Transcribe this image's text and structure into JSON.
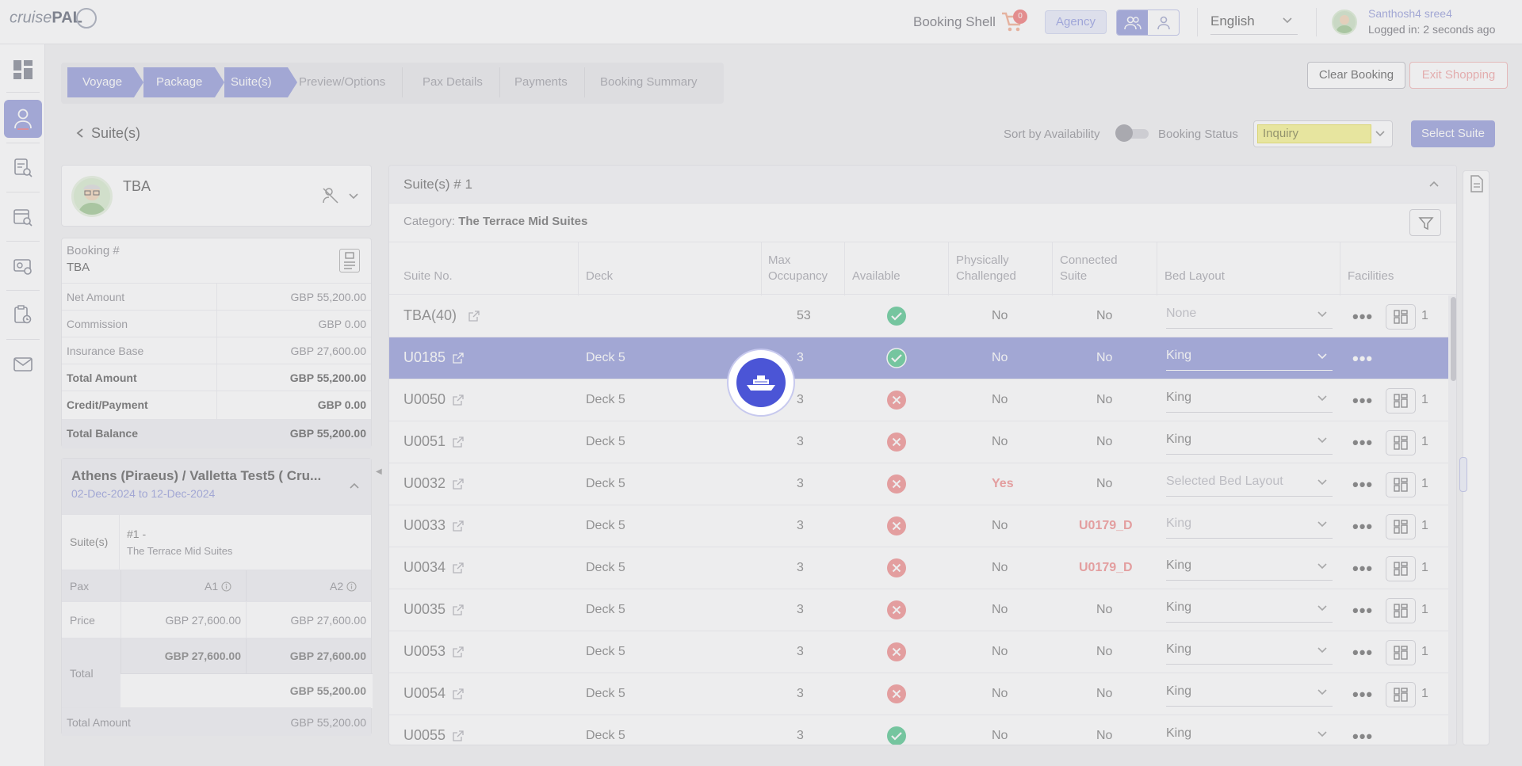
{
  "header": {
    "logo_text": "cruise",
    "logo_bold": "PAL",
    "booking_shell": "Booking Shell",
    "cart_count": "0",
    "agency": "Agency",
    "language": "English",
    "user_name": "Santhosh4 sree4",
    "logged_in": "Logged in: 2 seconds ago"
  },
  "stepper": {
    "steps": [
      "Voyage",
      "Package",
      "Suite(s)",
      "Preview/Options",
      "Pax Details",
      "Payments",
      "Booking Summary"
    ],
    "current": 2
  },
  "actions": {
    "clear_booking": "Clear Booking",
    "exit_shopping": "Exit Shopping"
  },
  "subbar": {
    "back_title": "Suite(s)",
    "sort_label": "Sort by Availability",
    "sort_on": false,
    "status_label": "Booking Status",
    "status_value": "Inquiry",
    "select_suite": "Select Suite"
  },
  "pax_card": {
    "name": "TBA"
  },
  "booking": {
    "label": "Booking #",
    "number": "TBA",
    "rows": [
      {
        "k": "Net Amount",
        "v": "GBP 55,200.00"
      },
      {
        "k": "Commission",
        "v": "GBP 0.00"
      },
      {
        "k": "Insurance Base",
        "v": "GBP 27,600.00"
      },
      {
        "k": "Total Amount",
        "v": "GBP 55,200.00"
      },
      {
        "k": "Credit/Payment",
        "v": "GBP 0.00"
      },
      {
        "k": "Total Balance",
        "v": "GBP 55,200.00"
      }
    ]
  },
  "voyage": {
    "title": "Athens (Piraeus) / Valletta Test5 ( Cru...",
    "dates": "02-Dec-2024 to 12-Dec-2024",
    "suites_label": "Suite(s)",
    "suite_no": "#1 -",
    "suite_cat": "The Terrace Mid Suites",
    "pax_label": "Pax",
    "a1": "A1",
    "a2": "A2",
    "price_label": "Price",
    "price_a1": "GBP 27,600.00",
    "price_a2": "GBP 27,600.00",
    "total_label": "Total",
    "total_a1": "GBP 27,600.00",
    "total_a2": "GBP 27,600.00",
    "total_sum": "GBP 55,200.00",
    "total_amount_label": "Total Amount",
    "total_amount": "GBP 55,200.00"
  },
  "suites": {
    "title": "Suite(s) # 1",
    "category_label": "Category:",
    "category": "The Terrace Mid Suites",
    "columns": [
      "Suite No.",
      "Deck",
      "Max\nOccupancy",
      "Available",
      "Physically\nChallenged",
      "Connected\nSuite",
      "Bed Layout",
      "Facilities"
    ],
    "rows": [
      {
        "no": "TBA(40)",
        "deck": "",
        "occ": "53",
        "avail": true,
        "pc": "No",
        "conn": "No",
        "bed": "None",
        "fac": "1",
        "bed_muted": true
      },
      {
        "no": "U0185",
        "deck": "Deck 5",
        "occ": "3",
        "avail": true,
        "pc": "No",
        "conn": "No",
        "bed": "King",
        "fac": "",
        "selected": true
      },
      {
        "no": "U0050",
        "deck": "Deck 5",
        "occ": "3",
        "avail": false,
        "pc": "No",
        "conn": "No",
        "bed": "King",
        "fac": "1"
      },
      {
        "no": "U0051",
        "deck": "Deck 5",
        "occ": "3",
        "avail": false,
        "pc": "No",
        "conn": "No",
        "bed": "King",
        "fac": "1"
      },
      {
        "no": "U0032",
        "deck": "Deck 5",
        "occ": "3",
        "avail": false,
        "pc": "Yes",
        "conn": "No",
        "bed": "Selected Bed Layout",
        "fac": "1",
        "bed_muted": true
      },
      {
        "no": "U0033",
        "deck": "Deck 5",
        "occ": "3",
        "avail": false,
        "pc": "No",
        "conn": "U0179_D",
        "bed": "King",
        "fac": "1",
        "bed_muted": true
      },
      {
        "no": "U0034",
        "deck": "Deck 5",
        "occ": "3",
        "avail": false,
        "pc": "No",
        "conn": "U0179_D",
        "bed": "King",
        "fac": "1"
      },
      {
        "no": "U0035",
        "deck": "Deck 5",
        "occ": "3",
        "avail": false,
        "pc": "No",
        "conn": "No",
        "bed": "King",
        "fac": "1"
      },
      {
        "no": "U0053",
        "deck": "Deck 5",
        "occ": "3",
        "avail": false,
        "pc": "No",
        "conn": "No",
        "bed": "King",
        "fac": "1"
      },
      {
        "no": "U0054",
        "deck": "Deck 5",
        "occ": "3",
        "avail": false,
        "pc": "No",
        "conn": "No",
        "bed": "King",
        "fac": "1"
      },
      {
        "no": "U0055",
        "deck": "Deck 5",
        "occ": "3",
        "avail": true,
        "pc": "No",
        "conn": "No",
        "bed": "King",
        "fac": ""
      }
    ]
  },
  "colors": {
    "accent": "#8f97d8",
    "loader": "#4b55d6",
    "status_yellow": "#f7f48a",
    "danger": "#f08a8a",
    "success": "#4cc38a"
  }
}
